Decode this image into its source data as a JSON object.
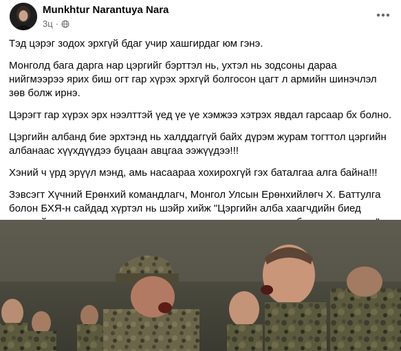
{
  "post": {
    "author": "Munkhtur Narantuya Nara",
    "timestamp": "3ц",
    "audience_icon": "globe-icon",
    "more_icon": "more-options-icon",
    "paragraphs": [
      "Тэд цэрэг зодох эрхгүй бдаг учир хашгирдаг юм гэнэ.",
      "Монголд бага дарга нар цэргийг бэрттэл нь, ухтэл нь зодсоны дараа нийгмээрээ ярих биш огт гар хүрэх эрхгүй болгосон цагт л армийн шинэчлэл зөв болж ирнэ.",
      "Цэрэгт гар хүрэх эрх нээлттэй үед үе үе хэмжээ хэтрэх явдал гарсаар бх болно.",
      "Цэргийн албанд бие эрхтэнд нь халддаггүй байх дүрэм журам тогттол цэргийн албанаас хүүхдүүдээ буцаан авцгаа ээжүүдээ!!!",
      "Хэний ч үрд эрүүл мэнд, амь насаараа хохирохгүй гэх баталгаа алга байна!!!",
      "Зэвсэгт Хүчний Ерөнхий командлагч, Монгол Улсын Ерөнхийлөгч Х. Баттулга болон БХЯ-н сайдад хүртэл нь шэйр хийж \"Цэргийн алба хаагчдийн биед хүрэхийг хатуу хориглосон заалт гаргахаас нааш хөвгүүдээ бүү цэрэгт явуул\""
    ]
  },
  "colors": {
    "text_primary": "#050505",
    "text_secondary": "#65676b",
    "background": "#ffffff"
  }
}
